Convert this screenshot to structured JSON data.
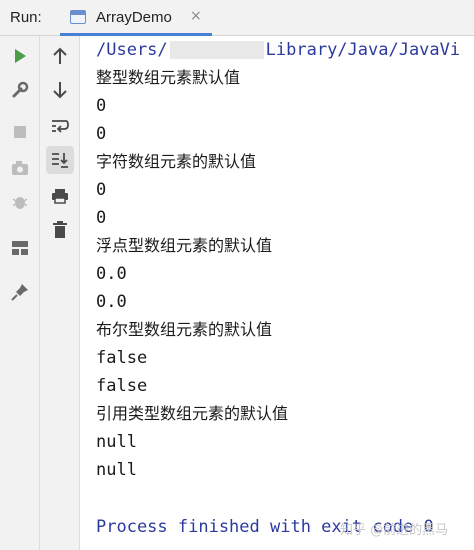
{
  "header": {
    "run_label": "Run:",
    "tab": {
      "title": "ArrayDemo",
      "close": "×"
    }
  },
  "console": {
    "path_start": "/Users/",
    "path_end": "Library/Java/JavaVi",
    "lines": [
      "整型数组元素默认值",
      "0",
      "0",
      "字符数组元素的默认值",
      "0",
      "0",
      "浮点型数组元素的默认值",
      "0.0",
      "0.0",
      "布尔型数组元素的默认值",
      "false",
      "false",
      "引用类型数组元素的默认值",
      "null",
      "null"
    ],
    "process_line": "Process finished with exit code 0"
  },
  "watermark": "知乎 @前进的黑马",
  "colors": {
    "run_green": "#4a9e4a",
    "accent_blue": "#4a7fd8",
    "path_blue": "#2c3a9e",
    "toolbar_bg": "#f2f2f2"
  },
  "icons": {
    "toolbar1": [
      "rerun-icon",
      "wrench-icon",
      "stop-icon",
      "camera-icon",
      "bug-icon",
      "layout-icon",
      "pin-icon"
    ],
    "toolbar2": [
      "arrow-up-icon",
      "arrow-down-icon",
      "soft-wrap-icon",
      "scroll-to-end-icon",
      "print-icon",
      "trash-icon"
    ]
  }
}
